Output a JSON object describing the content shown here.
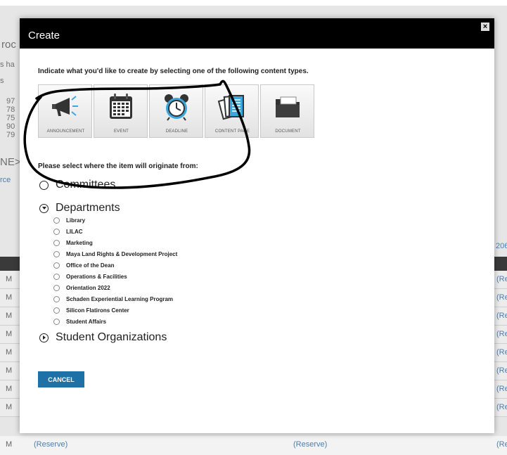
{
  "background": {
    "left_fragments": [
      "roc",
      "s ha",
      "s",
      "97",
      "78",
      "75",
      "90",
      "79",
      "NE>",
      "rce"
    ],
    "right_fragment": "206",
    "rows": [
      {
        "left": "M",
        "right": "(Re"
      },
      {
        "left": "M",
        "right": "(Re"
      },
      {
        "left": "M",
        "right": "(Re"
      },
      {
        "left": "M",
        "right": "(Re"
      },
      {
        "left": "M",
        "right": "(Re"
      },
      {
        "left": "M",
        "right": "(Re"
      },
      {
        "left": "M",
        "right": "(Re"
      },
      {
        "left": "M",
        "right": "(Re"
      },
      {
        "left": "M",
        "right": "(Re",
        "reserve_1": "(Reserve)",
        "reserve_2": "(Reserve)"
      }
    ]
  },
  "modal": {
    "title": "Create",
    "close_label": "×",
    "instruction": "Indicate what you'd like to create by selecting one of the following content types.",
    "content_types": [
      {
        "label": "ANNOUNCEMENT",
        "icon": "megaphone-icon"
      },
      {
        "label": "EVENT",
        "icon": "calendar-icon"
      },
      {
        "label": "DEADLINE",
        "icon": "alarm-clock-icon"
      },
      {
        "label": "CONTENT PAGE",
        "icon": "pages-icon"
      },
      {
        "label": "DOCUMENT",
        "icon": "folder-icon"
      }
    ],
    "origin_prompt": "Please select where the item will originate from:",
    "groups": {
      "committees": "Committees",
      "departments": "Departments",
      "student_orgs": "Student Organizations"
    },
    "departments": [
      "Library",
      "LILAC",
      "Marketing",
      "Maya Land Rights & Development Project",
      "Office of the Dean",
      "Operations & Facilities",
      "Orientation 2022",
      "Schaden Experiential Learning Program",
      "Silicon Flatirons Center",
      "Student Affairs"
    ],
    "cancel_label": "CANCEL"
  },
  "colors": {
    "header_bg": "#000000",
    "accent_button": "#1d71a6",
    "accent_icon": "#3aa7de",
    "link": "#4a7fb3"
  }
}
